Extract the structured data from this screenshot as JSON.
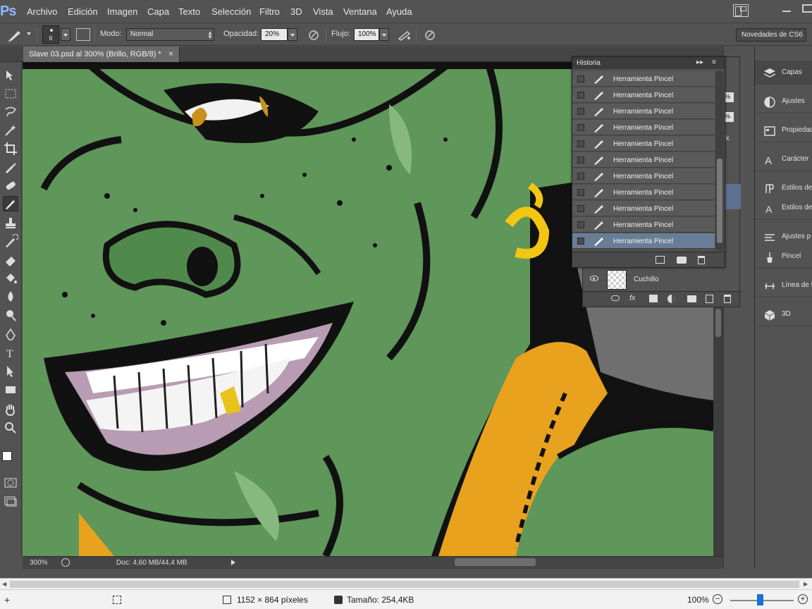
{
  "app": {
    "logo_text": "Ps",
    "menu": [
      "Archivo",
      "Edición",
      "Imagen",
      "Capa",
      "Texto",
      "Selección",
      "Filtro",
      "3D",
      "Vista",
      "Ventana",
      "Ayuda"
    ]
  },
  "options_bar": {
    "brush_size": "6",
    "mode_label": "Modo:",
    "mode_value": "Normal",
    "opacity_label": "Opacidad:",
    "opacity_value": "20%",
    "flow_label": "Flujo:",
    "flow_value": "100%",
    "workspace_button": "Novedades de CS6"
  },
  "document_tab": {
    "title": "Slave 03.psd al 300% (Brillo, RGB/8) *",
    "close": "×"
  },
  "status_bar": {
    "zoom": "300%",
    "doc_info": "Doc: 4,60 MB/44,4 MB"
  },
  "historia": {
    "title": "Historia",
    "items": [
      {
        "label": "Herramienta Pincel",
        "active": false
      },
      {
        "label": "Herramienta Pincel",
        "active": false
      },
      {
        "label": "Herramienta Pincel",
        "active": false
      },
      {
        "label": "Herramienta Pincel",
        "active": false
      },
      {
        "label": "Herramienta Pincel",
        "active": false
      },
      {
        "label": "Herramienta Pincel",
        "active": false
      },
      {
        "label": "Herramienta Pincel",
        "active": false
      },
      {
        "label": "Herramienta Pincel",
        "active": false
      },
      {
        "label": "Herramienta Pincel",
        "active": false
      },
      {
        "label": "Herramienta Pincel",
        "active": false
      },
      {
        "label": "Herramienta Pincel",
        "active": true
      }
    ]
  },
  "layers": {
    "visible_layer": "Cuchillo",
    "opacity_partial": "%",
    "fill_partial": "%"
  },
  "right_dock": [
    {
      "label": "Capas",
      "icon": "layers-icon",
      "active": true
    },
    {
      "label": "Ajustes",
      "icon": "adjustments-icon",
      "active": false
    },
    {
      "label": "Propiedad",
      "icon": "properties-icon",
      "active": false
    },
    {
      "label": "Carácter",
      "icon": "character-icon",
      "active": false
    },
    {
      "label": "Estilos de",
      "icon": "styles-icon",
      "active": false
    },
    {
      "label": "Estilos de",
      "icon": "char-styles-icon",
      "active": false
    },
    {
      "label": "Ajustes p",
      "icon": "brush-presets-icon",
      "active": false
    },
    {
      "label": "Pincel",
      "icon": "brush-icon",
      "active": false
    },
    {
      "label": "Línea de t",
      "icon": "timeline-icon",
      "active": false
    },
    {
      "label": "3D",
      "icon": "3d-icon",
      "active": false
    }
  ],
  "viewer_bar": {
    "dimensions": "1152 × 864 píxeles",
    "size": "Tamaño: 254,4KB",
    "zoom": "100%",
    "zoom_level": 0.45
  },
  "colors": {
    "canvas_green": "#5f965a",
    "history_active": "#6a7d96",
    "accent_orange": "#e8a21e"
  }
}
